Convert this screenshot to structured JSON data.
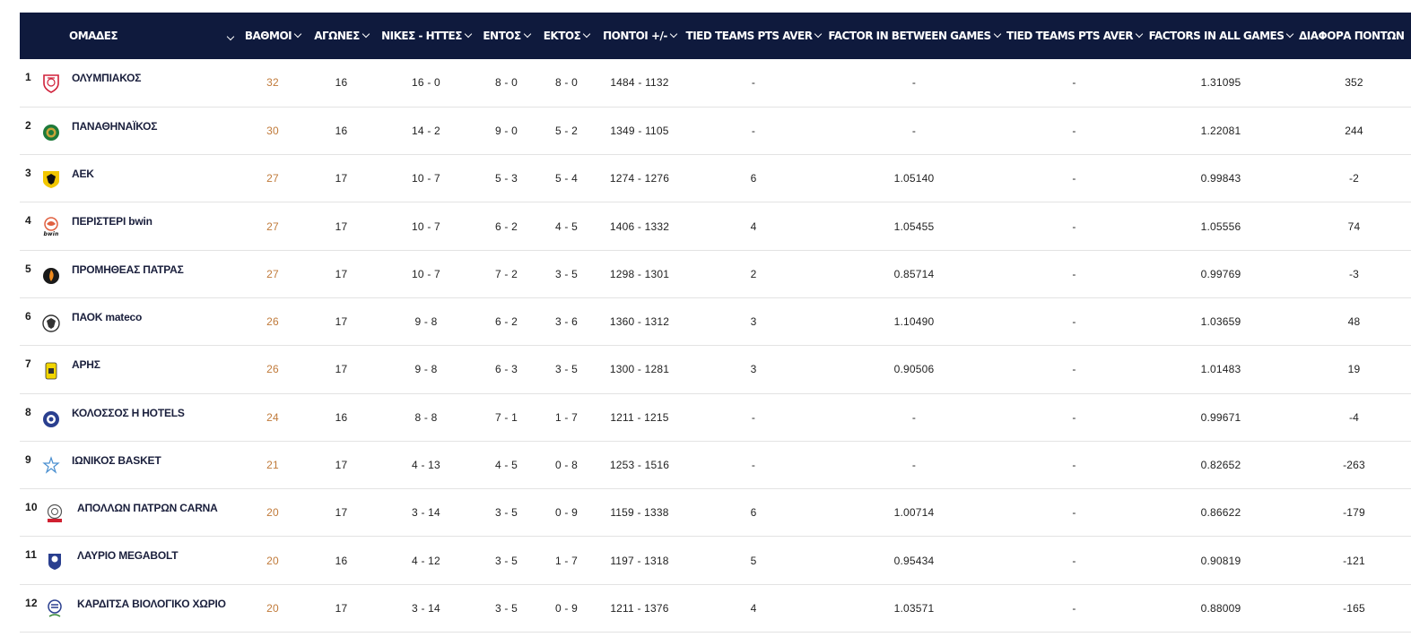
{
  "header": {
    "team": "ΟΜΑΔΕΣ",
    "points": "ΒΑΘΜΟΙ",
    "games": "ΑΓΩΝΕΣ",
    "wl": "ΝΙΚΕΣ - ΗΤΤΕΣ",
    "home": "ΕΝΤΟΣ",
    "away": "ΕΚΤΟΣ",
    "scores": "ΠΟΝΤΟΙ +/-",
    "tied1": "TIED TEAMS PTS AVER",
    "factor_between": "FACTOR IN BETWEEN GAMES",
    "tied2": "TIED TEAMS PTS AVER",
    "factors_all": "FACTORS IN ALL GAMES",
    "diff": "ΔΙΑΦΟΡΑ ΠΟΝΤΩΝ"
  },
  "colors": {
    "header_bg": "#0f1a3d",
    "points_text": "#c07a3a",
    "team_text": "#1a1f3c",
    "row_border": "#e3e3e3"
  },
  "rows": [
    {
      "rank": "1",
      "team": "ΟΛΥΜΠΙΑΚΟΣ",
      "logo": "olympiacos-logo",
      "pts": "32",
      "games": "16",
      "wl": "16 - 0",
      "home": "8 - 0",
      "away": "8 - 0",
      "scores": "1484 - 1132",
      "tied1": "-",
      "factor_between": "-",
      "tied2": "-",
      "factors_all": "1.31095",
      "diff": "352"
    },
    {
      "rank": "2",
      "team": "ΠΑΝΑΘΗΝΑΪΚΟΣ",
      "logo": "panathinaikos-logo",
      "pts": "30",
      "games": "16",
      "wl": "14 - 2",
      "home": "9 - 0",
      "away": "5 - 2",
      "scores": "1349 - 1105",
      "tied1": "-",
      "factor_between": "-",
      "tied2": "-",
      "factors_all": "1.22081",
      "diff": "244"
    },
    {
      "rank": "3",
      "team": "ΑΕΚ",
      "logo": "aek-logo",
      "pts": "27",
      "games": "17",
      "wl": "10 - 7",
      "home": "5 - 3",
      "away": "5 - 4",
      "scores": "1274 - 1276",
      "tied1": "6",
      "factor_between": "1.05140",
      "tied2": "-",
      "factors_all": "0.99843",
      "diff": "-2"
    },
    {
      "rank": "4",
      "team": "ΠΕΡΙΣΤΕΡΙ bwin",
      "logo": "peristeri-logo",
      "pts": "27",
      "games": "17",
      "wl": "10 - 7",
      "home": "6 - 2",
      "away": "4 - 5",
      "scores": "1406 - 1332",
      "tied1": "4",
      "factor_between": "1.05455",
      "tied2": "-",
      "factors_all": "1.05556",
      "diff": "74",
      "logo_text": "bwin"
    },
    {
      "rank": "5",
      "team": "ΠΡΟΜΗΘΕΑΣ ΠΑΤΡΑΣ",
      "logo": "promitheas-logo",
      "pts": "27",
      "games": "17",
      "wl": "10 - 7",
      "home": "7 - 2",
      "away": "3 - 5",
      "scores": "1298 - 1301",
      "tied1": "2",
      "factor_between": "0.85714",
      "tied2": "-",
      "factors_all": "0.99769",
      "diff": "-3"
    },
    {
      "rank": "6",
      "team": "ΠΑΟΚ mateco",
      "logo": "paok-logo",
      "pts": "26",
      "games": "17",
      "wl": "9 - 8",
      "home": "6 - 2",
      "away": "3 - 6",
      "scores": "1360 - 1312",
      "tied1": "3",
      "factor_between": "1.10490",
      "tied2": "-",
      "factors_all": "1.03659",
      "diff": "48"
    },
    {
      "rank": "7",
      "team": "ΑΡΗΣ",
      "logo": "aris-logo",
      "pts": "26",
      "games": "17",
      "wl": "9 - 8",
      "home": "6 - 3",
      "away": "3 - 5",
      "scores": "1300 - 1281",
      "tied1": "3",
      "factor_between": "0.90506",
      "tied2": "-",
      "factors_all": "1.01483",
      "diff": "19"
    },
    {
      "rank": "8",
      "team": "ΚΟΛΟΣΣΟΣ Η HOTELS",
      "logo": "kolossos-logo",
      "pts": "24",
      "games": "16",
      "wl": "8 - 8",
      "home": "7 - 1",
      "away": "1 - 7",
      "scores": "1211 - 1215",
      "tied1": "-",
      "factor_between": "-",
      "tied2": "-",
      "factors_all": "0.99671",
      "diff": "-4"
    },
    {
      "rank": "9",
      "team": "ΙΩΝΙΚΟΣ BASKET",
      "logo": "ionikos-logo",
      "pts": "21",
      "games": "17",
      "wl": "4 - 13",
      "home": "4 - 5",
      "away": "0 - 8",
      "scores": "1253 - 1516",
      "tied1": "-",
      "factor_between": "-",
      "tied2": "-",
      "factors_all": "0.82652",
      "diff": "-263"
    },
    {
      "rank": "10",
      "team": "ΑΠΟΛΛΩΝ ΠΑΤΡΩΝ CARNA",
      "logo": "apollon-logo",
      "pts": "20",
      "games": "17",
      "wl": "3 - 14",
      "home": "3 - 5",
      "away": "0 - 9",
      "scores": "1159 - 1338",
      "tied1": "6",
      "factor_between": "1.00714",
      "tied2": "-",
      "factors_all": "0.86622",
      "diff": "-179"
    },
    {
      "rank": "11",
      "team": "ΛΑΥΡΙΟ MEGABOLT",
      "logo": "lavrio-logo",
      "pts": "20",
      "games": "16",
      "wl": "4 - 12",
      "home": "3 - 5",
      "away": "1 - 7",
      "scores": "1197 - 1318",
      "tied1": "5",
      "factor_between": "0.95434",
      "tied2": "-",
      "factors_all": "0.90819",
      "diff": "-121"
    },
    {
      "rank": "12",
      "team": "ΚΑΡΔΙΤΣΑ ΒΙΟΛΟΓΙΚΟ ΧΩΡΙΟ",
      "logo": "karditsa-logo",
      "pts": "20",
      "games": "17",
      "wl": "3 - 14",
      "home": "3 - 5",
      "away": "0 - 9",
      "scores": "1211 - 1376",
      "tied1": "4",
      "factor_between": "1.03571",
      "tied2": "-",
      "factors_all": "0.88009",
      "diff": "-165"
    }
  ]
}
